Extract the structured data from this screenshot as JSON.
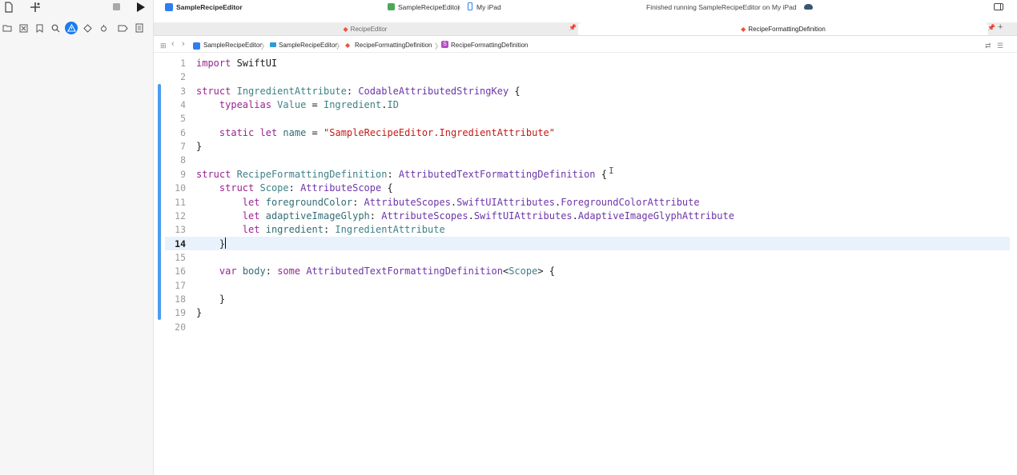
{
  "toolbar": {
    "app_name": "SampleRecipeEditor",
    "scheme": "SampleRecipeEditor",
    "device": "My iPad",
    "status": "Finished running SampleRecipeEditor on My iPad"
  },
  "tabs": [
    {
      "label": "RecipeEditor",
      "active": false
    },
    {
      "label": "RecipeFormattingDefinition",
      "active": true
    }
  ],
  "breadcrumb": [
    "SampleRecipeEditor",
    "SampleRecipeEditor",
    "RecipeFormattingDefinition",
    "RecipeFormattingDefinition"
  ],
  "breadcrumb_badge": "S",
  "code": {
    "current_line": 14,
    "lines": [
      {
        "n": "1",
        "text": "import SwiftUI"
      },
      {
        "n": "2",
        "text": ""
      },
      {
        "n": "3",
        "text": "struct IngredientAttribute: CodableAttributedStringKey {"
      },
      {
        "n": "4",
        "text": "    typealias Value = Ingredient.ID"
      },
      {
        "n": "5",
        "text": ""
      },
      {
        "n": "6",
        "text": "    static let name = \"SampleRecipeEditor.IngredientAttribute\""
      },
      {
        "n": "7",
        "text": "}"
      },
      {
        "n": "8",
        "text": ""
      },
      {
        "n": "9",
        "text": "struct RecipeFormattingDefinition: AttributedTextFormattingDefinition {"
      },
      {
        "n": "10",
        "text": "    struct Scope: AttributeScope {"
      },
      {
        "n": "11",
        "text": "        let foregroundColor: AttributeScopes.SwiftUIAttributes.ForegroundColorAttribute"
      },
      {
        "n": "12",
        "text": "        let adaptiveImageGlyph: AttributeScopes.SwiftUIAttributes.AdaptiveImageGlyphAttribute"
      },
      {
        "n": "13",
        "text": "        let ingredient: IngredientAttribute"
      },
      {
        "n": "14",
        "text": "    }"
      },
      {
        "n": "15",
        "text": ""
      },
      {
        "n": "16",
        "text": "    var body: some AttributedTextFormattingDefinition<Scope> {"
      },
      {
        "n": "17",
        "text": ""
      },
      {
        "n": "18",
        "text": "    }"
      },
      {
        "n": "19",
        "text": "}"
      },
      {
        "n": "20",
        "text": ""
      }
    ]
  },
  "colors": {
    "accent": "#1a7cf0",
    "keyword": "#9b2393",
    "string": "#c41a16",
    "type": "#6c36a9",
    "project_type": "#3e8087",
    "current_line_bg": "#e8f2fd"
  }
}
